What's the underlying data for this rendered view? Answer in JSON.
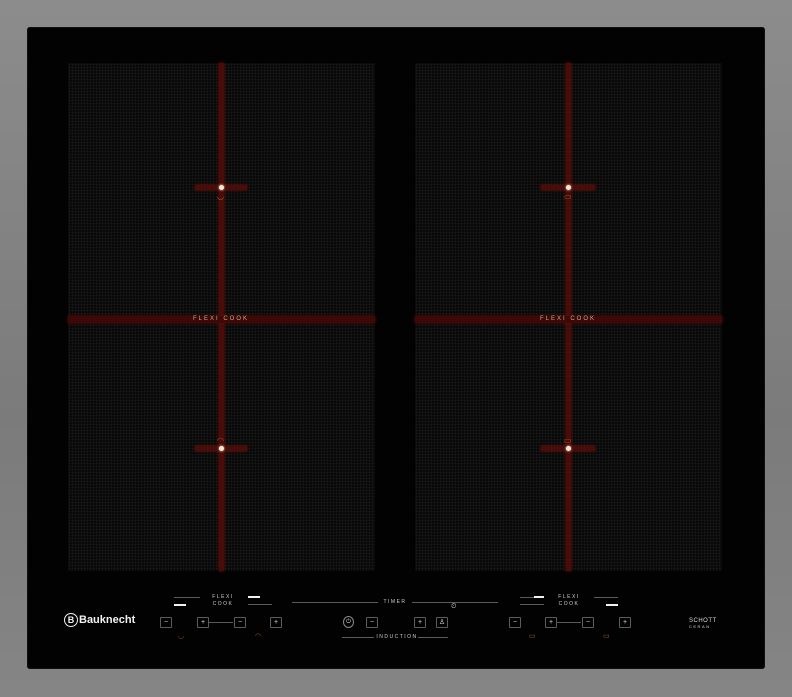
{
  "brand": "Bauknecht",
  "glass_brand": {
    "line1": "SCHOTT",
    "line2": "CERAN"
  },
  "zones": {
    "left": {
      "flexi_label": "FLEXI COOK"
    },
    "right": {
      "flexi_label": "FLEXI COOK"
    }
  },
  "controls": {
    "left_group": {
      "flexi_line1": "FLEXI",
      "flexi_line2": "COOK"
    },
    "right_group": {
      "flexi_line1": "FLEXI",
      "flexi_line2": "COOK"
    },
    "timer_label": "TIMER",
    "induction_label": "INDUCTION",
    "minus": "−",
    "plus": "+",
    "power": "⏻",
    "lock": "♙",
    "timer_icon": "⏲"
  },
  "colors": {
    "frame": "#8e8e8e",
    "glass": "#020202",
    "zone_line": "#4a0c08",
    "icon": "#b0582a"
  }
}
